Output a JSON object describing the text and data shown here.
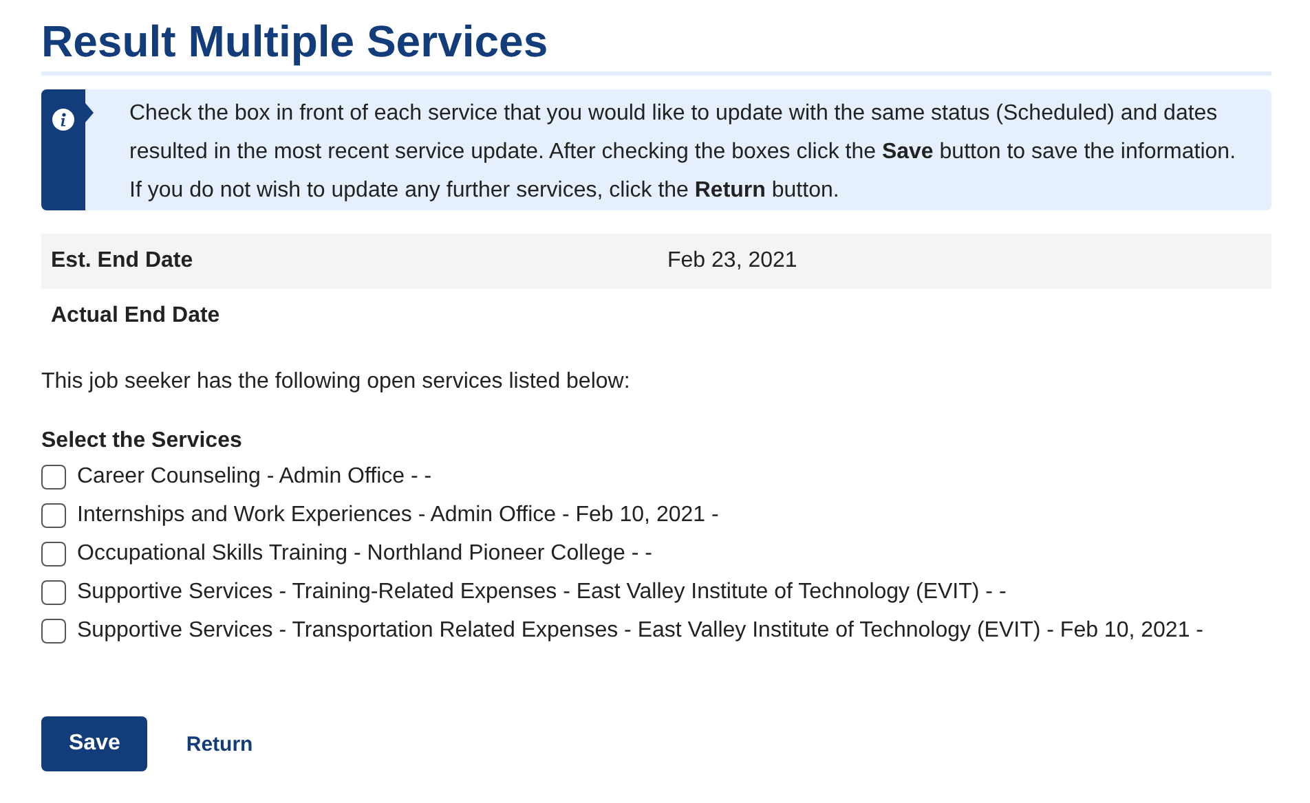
{
  "title": "Result Multiple Services",
  "info": {
    "text": "Check the box in front of each service that you would like to update with the same status (Scheduled) and dates resulted in the most recent service update. After checking the boxes click the **Save** button to save the information. If you do not wish to update any further services, click the **Return** button."
  },
  "details": [
    {
      "label": "Est. End Date",
      "value": "Feb 23, 2021"
    },
    {
      "label": "Actual End Date"
    }
  ],
  "intro": "This job seeker has the following open services listed below:",
  "services_heading": "Select the Services",
  "services": [
    {
      "label": "Career Counseling - Admin Office - -",
      "checked": false
    },
    {
      "label": "Internships and Work Experiences - Admin Office - Feb 10, 2021 -",
      "checked": false
    },
    {
      "label": "Occupational Skills Training - Northland Pioneer College - -",
      "checked": false
    },
    {
      "label": "Supportive Services - Training-Related Expenses - East Valley Institute of Technology (EVIT) - -",
      "checked": false
    },
    {
      "label": "Supportive Services - Transportation Related Expenses - East Valley Institute of Technology (EVIT) - Feb 10, 2021 -",
      "checked": false
    }
  ],
  "buttons": [
    {
      "label": "Save",
      "kind": "primary"
    },
    {
      "label": "Return",
      "kind": "link"
    }
  ]
}
